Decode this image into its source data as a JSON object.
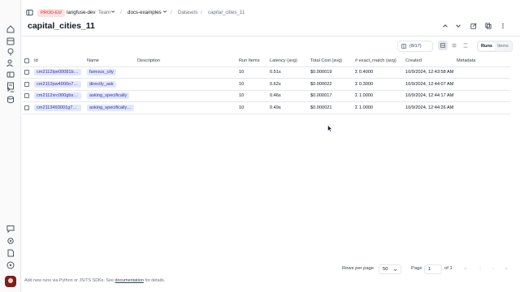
{
  "topbar": {
    "env_badge": "PROD-EU",
    "org": "langfuse-dev",
    "org_badge": "Team",
    "project": "docs-examples",
    "section": "Datasets",
    "dataset": "capital_cities_11"
  },
  "header": {
    "title": "capital_cities_11"
  },
  "toolbar": {
    "columns": "(8/17)",
    "tab_runs": "Runs",
    "tab_items": "Items"
  },
  "table": {
    "headers": [
      "Id",
      "Name",
      "Description",
      "Run Items",
      "Latency (avg)",
      "Total Cost (avg)",
      "# exact_match (avg)",
      "Created",
      "Metadata"
    ],
    "rows": [
      {
        "id": "cm2112lpe00081bw...",
        "name": "famous_city",
        "description": "",
        "run_items": "10",
        "latency": "0.51s",
        "cost": "$0.000019",
        "exact_match": "Σ 0.4000",
        "created": "10/9/2024, 12:43:58 AM",
        "metadata": ""
      },
      {
        "id": "cm2112pw4000o7g...",
        "name": "directly_ask",
        "description": "",
        "run_items": "10",
        "latency": "0.62s",
        "cost": "$0.000022",
        "exact_match": "Σ 0.3000",
        "created": "10/9/2024, 12:44:07 AM",
        "metadata": ""
      },
      {
        "id": "cm2112xrc000gbso...",
        "name": "asking_specifically",
        "description": "",
        "run_items": "10",
        "latency": "0.46s",
        "cost": "$0.000017",
        "exact_match": "Σ 1.0000",
        "created": "10/9/2024, 12:44:17 AM",
        "metadata": ""
      },
      {
        "id": "cm2113493001g7g4...",
        "name": "asking_specifically_...",
        "description": "",
        "run_items": "10",
        "latency": "0.49s",
        "cost": "$0.000021",
        "exact_match": "Σ 1.0000",
        "created": "10/9/2024, 12:44:26 AM",
        "metadata": ""
      }
    ]
  },
  "footer": {
    "hint_prefix": "Add new runs via Python or JS/TS SDKs. See",
    "hint_link": "documentation",
    "hint_suffix": "for details.",
    "rows_per_page_label": "Rows per page",
    "rows_per_page": "50",
    "page_label": "Page",
    "page": "1",
    "of_pages": "of 1"
  },
  "colors": {
    "accent_pill_bg": "#e0e7ff",
    "accent_pill_text": "#3730a3",
    "env_badge_bg": "#fee2e2",
    "env_badge_text": "#dc2626"
  },
  "icons": [
    "sidebar-toggle-icon",
    "home-icon",
    "dashboard-icon",
    "lightbulb-icon",
    "users-icon",
    "datasets-icon",
    "prompts-icon",
    "terminal-icon",
    "database-icon",
    "chat-icon",
    "settings-icon",
    "docs-icon",
    "help-icon"
  ]
}
